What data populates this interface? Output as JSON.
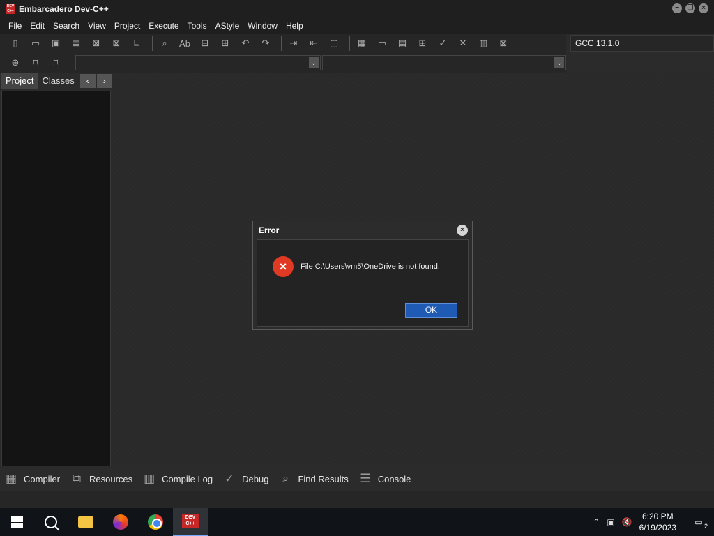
{
  "window": {
    "title": "Embarcadero Dev-C++",
    "logo_text": "DEV C++"
  },
  "menu": [
    "File",
    "Edit",
    "Search",
    "View",
    "Project",
    "Execute",
    "Tools",
    "AStyle",
    "Window",
    "Help"
  ],
  "toolbar": {
    "compiler": "GCC 13.1.0",
    "row1_icons": [
      "new-file-icon",
      "open-icon",
      "save-icon",
      "save-all-icon",
      "close-icon",
      "close-all-icon",
      "print-icon",
      "find-icon",
      "replace-icon",
      "goto-icon",
      "toggle-icon",
      "undo-icon",
      "redo-icon",
      "indent-icon",
      "unindent-icon",
      "comment-icon",
      "grid-icon",
      "window-icon",
      "table-icon",
      "tiles-icon",
      "check-icon",
      "cancel-icon",
      "chart-icon",
      "clear-icon"
    ],
    "row2_icons": [
      "class-browser-icon",
      "bookmark-icon",
      "bookmarks-icon"
    ]
  },
  "left_tabs": {
    "project": "Project",
    "classes": "Classes",
    "prev": "‹",
    "next": "›"
  },
  "bottom_tabs": [
    {
      "label": "Compiler",
      "icon": "compiler-icon"
    },
    {
      "label": "Resources",
      "icon": "resources-icon"
    },
    {
      "label": "Compile Log",
      "icon": "compile-log-icon"
    },
    {
      "label": "Debug",
      "icon": "debug-icon"
    },
    {
      "label": "Find Results",
      "icon": "find-results-icon"
    },
    {
      "label": "Console",
      "icon": "console-icon"
    }
  ],
  "dialog": {
    "title": "Error",
    "message": "File C:\\Users\\vm5\\OneDrive is not found.",
    "ok": "OK"
  },
  "taskbar": {
    "time": "6:20 PM",
    "date": "6/19/2023",
    "notifications": "2"
  }
}
